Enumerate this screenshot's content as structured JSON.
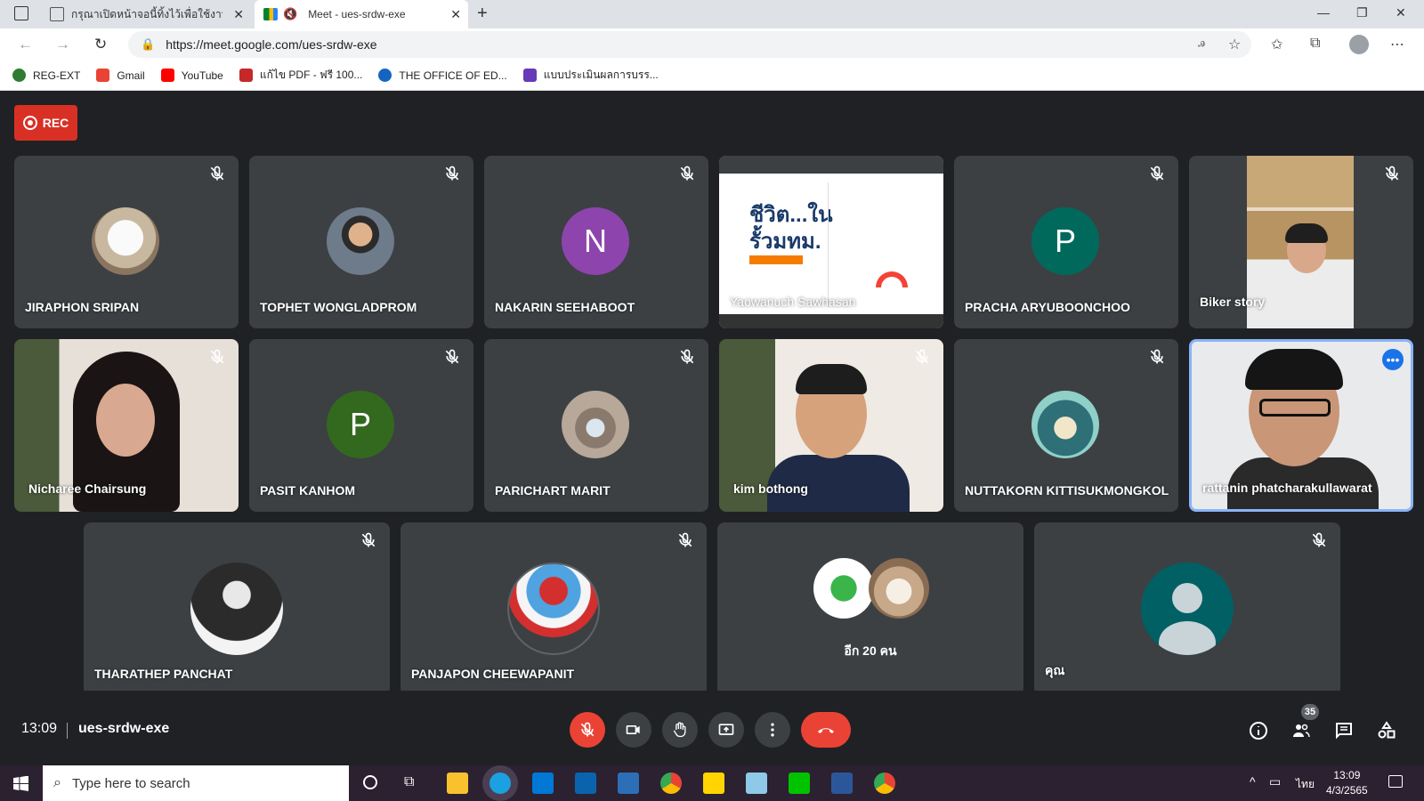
{
  "browser": {
    "tabs": [
      {
        "title": "กรุณาเปิดหน้าจอนี้ทิ้งไว้เพื่อใช้งาน Inte",
        "active": false
      },
      {
        "title": "Meet - ues-srdw-exe",
        "active": true
      }
    ],
    "new_tab": "+",
    "url": "https://meet.google.com/ues-srdw-exe",
    "bookmarks": [
      {
        "label": "REG-EXT",
        "color": "#2e7d32"
      },
      {
        "label": "Gmail",
        "color": "#ea4335"
      },
      {
        "label": "YouTube",
        "color": "#ff0000"
      },
      {
        "label": "แก้ไข PDF - ฟรี 100...",
        "color": "#c62828"
      },
      {
        "label": "THE OFFICE OF ED...",
        "color": "#1565c0"
      },
      {
        "label": "แบบประเมินผลการบรร...",
        "color": "#673ab7"
      }
    ]
  },
  "meet": {
    "rec_label": "REC",
    "participants": [
      {
        "name": "JIRAPHON SRIPAN",
        "kind": "photo-avatar",
        "muted": true
      },
      {
        "name": "TOPHET WONGLADPROM",
        "kind": "photo-avatar",
        "muted": true
      },
      {
        "name": "NAKARIN SEEHABOOT",
        "kind": "letter",
        "letter": "N",
        "color": "#8e44ad",
        "muted": true
      },
      {
        "name": "Yaowanuch Sawhasan",
        "kind": "screen-share",
        "muted": false,
        "screen_text": [
          "ชีวิต...ใน",
          "รั้วมทม."
        ]
      },
      {
        "name": "PRACHA ARYUBOONCHOO",
        "kind": "letter",
        "letter": "P",
        "color": "#00695c",
        "muted": true
      },
      {
        "name": "Biker story",
        "kind": "video",
        "muted": true
      },
      {
        "name": "Nicharee Chairsung",
        "kind": "video",
        "muted": true
      },
      {
        "name": "PASIT KANHOM",
        "kind": "letter",
        "letter": "P",
        "color": "#33691e",
        "muted": true
      },
      {
        "name": "PARICHART MARIT",
        "kind": "photo-avatar",
        "muted": true
      },
      {
        "name": "kim bothong",
        "kind": "video",
        "muted": true
      },
      {
        "name": "NUTTAKORN KITTISUKMONGKOL",
        "kind": "photo-avatar",
        "muted": true
      },
      {
        "name": "rattanin phatcharakullawarat",
        "kind": "video",
        "muted": false,
        "speaking": true
      },
      {
        "name": "THARATHEP PANCHAT",
        "kind": "photo-avatar",
        "muted": true
      },
      {
        "name": "PANJAPON CHEEWAPANIT",
        "kind": "photo-avatar",
        "muted": true
      },
      {
        "name": "อีก 20 คน",
        "kind": "others",
        "muted": false
      },
      {
        "name": "คุณ",
        "kind": "self",
        "muted": true
      }
    ],
    "clock": "13:09",
    "meeting_code": "ues-srdw-exe",
    "people_count": "35"
  },
  "taskbar": {
    "search_placeholder": "Type here to search",
    "lang": "ไทย",
    "time": "13:09",
    "date": "4/3/2565"
  }
}
